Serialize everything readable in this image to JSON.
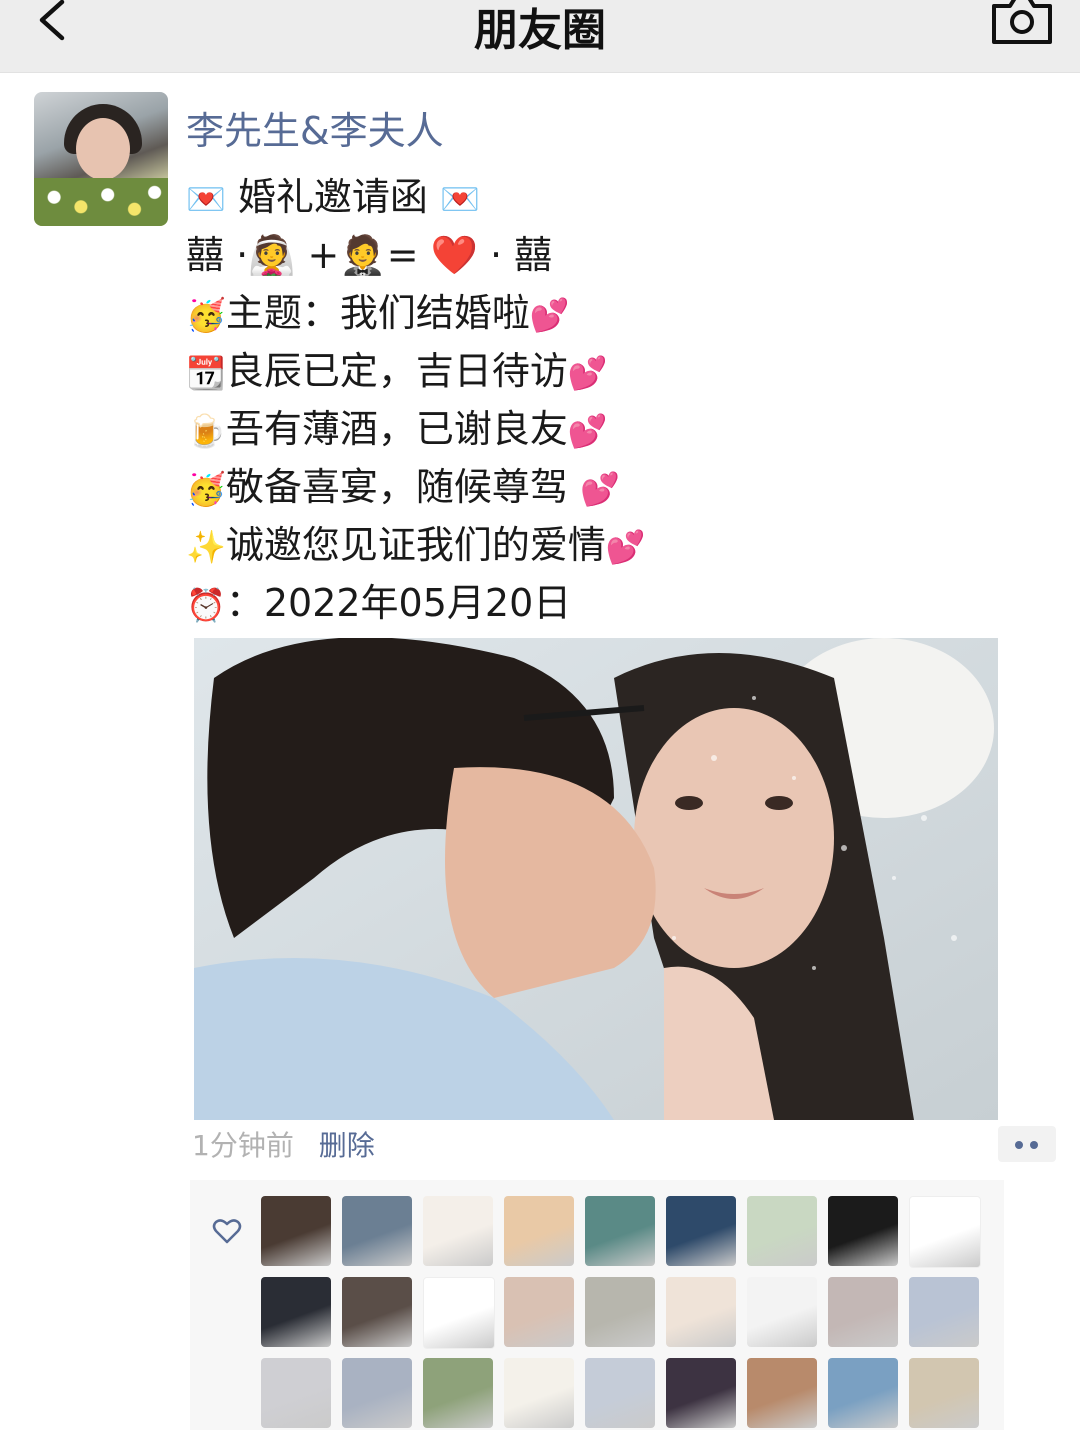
{
  "nav": {
    "title": "朋友圈"
  },
  "post": {
    "author": "李先生&李夫人",
    "lines": [
      {
        "emoji_left": "💌",
        "text": " 婚礼邀请函 ",
        "emoji_right": "💌"
      },
      {
        "text": "囍 ·👰 +🤵= ❤️ · 囍"
      },
      {
        "emoji_left": "🥳",
        "text": "主题：我们结婚啦",
        "emoji_right": "💕"
      },
      {
        "emoji_left": "📆",
        "text": "良辰已定，吉日待访",
        "emoji_right": "💕"
      },
      {
        "emoji_left": "🍺",
        "text": "吾有薄酒，已谢良友",
        "emoji_right": "💕"
      },
      {
        "emoji_left": "🥳",
        "text": "敬备喜宴，随候尊驾 ",
        "emoji_right": "💕"
      },
      {
        "emoji_left": "✨",
        "text": "诚邀您见证我们的爱情",
        "emoji_right": "💕"
      },
      {
        "emoji_left": "⏰",
        "text": "：2022年05月20日"
      }
    ],
    "time": "1分钟前",
    "delete_label": "删除"
  },
  "colors": {
    "link": "#576b95",
    "nav_bg": "#ededed",
    "likes_bg": "#f7f7f7"
  },
  "likes": {
    "icon": "heart-outline-icon",
    "avatars": [
      "#4a3b33",
      "#6b7f93",
      "#f4efe9",
      "#e9c9a6",
      "#5a8a86",
      "#2e4a6a",
      "#c9d8c2",
      "#1b1b1b",
      "#ffffff",
      "#2a2d35",
      "#5a4e48",
      "#ffffff",
      "#d9c1b3",
      "#b7b6ad",
      "#efe3d8",
      "#f3f3f3",
      "#c3b7b5",
      "#b9c3d4",
      "#cfcfd3",
      "#a9b2c2",
      "#8ea27a",
      "#f4f1ea",
      "#c5ccd8",
      "#3d3342",
      "#b88a6b",
      "#7aa0c2",
      "#d2c6b0"
    ]
  }
}
